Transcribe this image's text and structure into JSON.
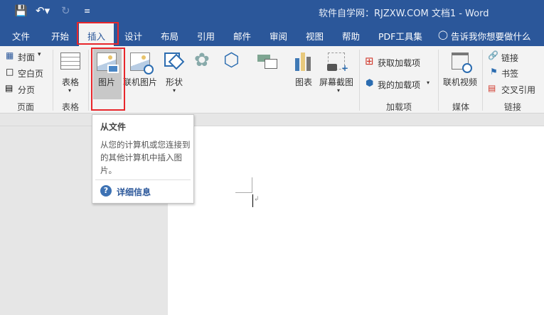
{
  "titlebar": {
    "title": "软件自学网：RJZXW.COM 文档1  -  Word",
    "save_icon": "save-icon",
    "undo_icon": "undo-icon",
    "redo_icon": "redo-icon",
    "customize_icon": "customize-qat-icon"
  },
  "tabs": [
    "文件",
    "开始",
    "插入",
    "设计",
    "布局",
    "引用",
    "邮件",
    "审阅",
    "视图",
    "帮助",
    "PDF工具集"
  ],
  "active_tab": "插入",
  "tell_me": "告诉我你想要做什么",
  "ribbon": {
    "pages": {
      "cover": "封面",
      "blank": "空白页",
      "break": "分页",
      "group": "页面"
    },
    "tables": {
      "table": "表格",
      "group": "表格"
    },
    "illustrations": {
      "pictures": "图片",
      "online_pictures": "联机图片",
      "shapes": "形状",
      "chart": "图表",
      "screenshot": "屏幕截图"
    },
    "addins": {
      "get": "获取加载项",
      "my": "我的加载项",
      "group": "加载项"
    },
    "media": {
      "online_video": "联机视频",
      "group": "媒体"
    },
    "links": {
      "link": "链接",
      "bookmark": "书签",
      "cross_ref": "交叉引用",
      "group": "链接"
    }
  },
  "tooltip": {
    "title": "从文件",
    "body": "从您的计算机或您连接到的其他计算机中插入图片。",
    "more": "详细信息"
  },
  "colors": {
    "brand": "#2b579a",
    "highlight": "#e8262b"
  }
}
